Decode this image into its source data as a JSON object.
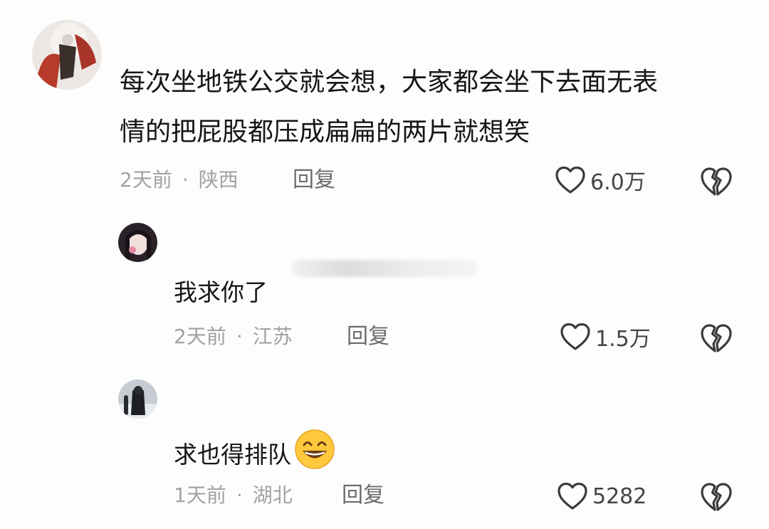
{
  "comments": [
    {
      "text_line1": "每次坐地铁公交就会想，大家都会坐下去面无表",
      "text_line2": "情的把屁股都压成扁扁的两片就想笑",
      "time": "2天前",
      "location": "陕西",
      "reply_label": "回复",
      "likes": "6.0万"
    },
    {
      "text": "我求你了",
      "time": "2天前",
      "location": "江苏",
      "reply_label": "回复",
      "likes": "1.5万"
    },
    {
      "text": "求也得排队",
      "emoji": "grinning-face-emoji",
      "time": "1天前",
      "location": "湖北",
      "reply_label": "回复",
      "likes": "5282"
    }
  ],
  "separator": "·",
  "icons": {
    "like": "heart-outline-icon",
    "dislike": "broken-heart-icon"
  },
  "colors": {
    "text": "#161616",
    "meta": "#a2a2a2",
    "icon": "#3a3a3a",
    "emoji": "#ffc83d"
  }
}
